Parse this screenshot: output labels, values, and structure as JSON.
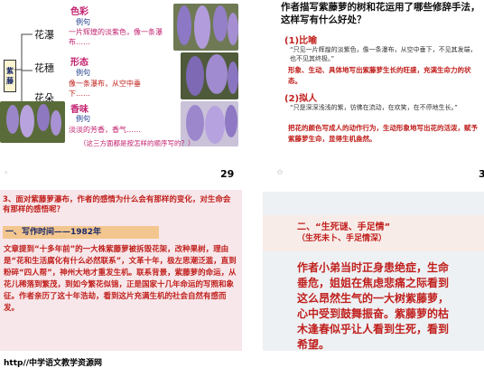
{
  "slide1": {
    "side_label": "紫藤",
    "branches": [
      "花瀑",
      "花穗",
      "花朵"
    ],
    "aspects": [
      {
        "label": "色彩",
        "eg": "例句",
        "text": "一片辉煌的淡紫色，像一条瀑布……"
      },
      {
        "label": "形态",
        "eg": "例句",
        "text": "像一条瀑布，从空中垂下……"
      },
      {
        "label": "香味",
        "eg": "例句",
        "text": "淡淡的芳香，香气……"
      }
    ],
    "caption": "（这三方面都是按怎样的顺序写的？）",
    "page_num": "29"
  },
  "slide2": {
    "title": "作者描写紫藤萝的树和花运用了哪些修辞手法，这样写有什么好处？",
    "h1": "(1)比喻",
    "q1": "“只见一片辉煌的淡紫色，像一条瀑布，从空中垂下，不见其发端，也不见其终极。”",
    "p1": "形象、生动、具体地写出紫藤萝生长的旺盛，充满生命力的状态。",
    "h2": "(2)拟人",
    "q2": "“只是深深浅浅的紫，彷佛在流动，在欢笑，在不停地生长。”",
    "p2": "把花的颜色写成人的动作行为，生动形象地写出花的活泼，赋予紫藤萝生命，显得生机盎然。",
    "page_num": "3",
    "glyph": "☆"
  },
  "slide3": {
    "question": "3、面对紫藤萝瀑布，作者的感情为什么会有那样的变化，对生命会有那样的感悟呢？",
    "section": "一、写作时间——1982年",
    "paragraph": "文章提到“十多年前”的一大株紫藤萝被拆毁花架，改种果树，理由是“花和生活腐化有什么必然联系”，文革十年，极左思潮泛滥，直到粉碎“四人帮”，神州大地才重发生机。联系背景，紫藤萝的命运，从花儿稀落到繁茂，到如今繁花似锦，正是国家十几年命运的写照和象征。作者亲历了这十年浩劫，看到这片充满生机的社会自然有感而发。"
  },
  "slide4": {
    "heading": "二、“生死谜、手足情”",
    "subheading": "（生死未卜、手足情深）",
    "body": "作者小弟当时正身患绝症，生命垂危，姐姐在焦虑悲痛之际看到这么昂然生气的一大树紫藤萝，心中受到鼓舞振奋。紫藤萝的枯木逢春似乎让人看到生死，看到希望。"
  },
  "footer": "http//中学语文教学资源网"
}
